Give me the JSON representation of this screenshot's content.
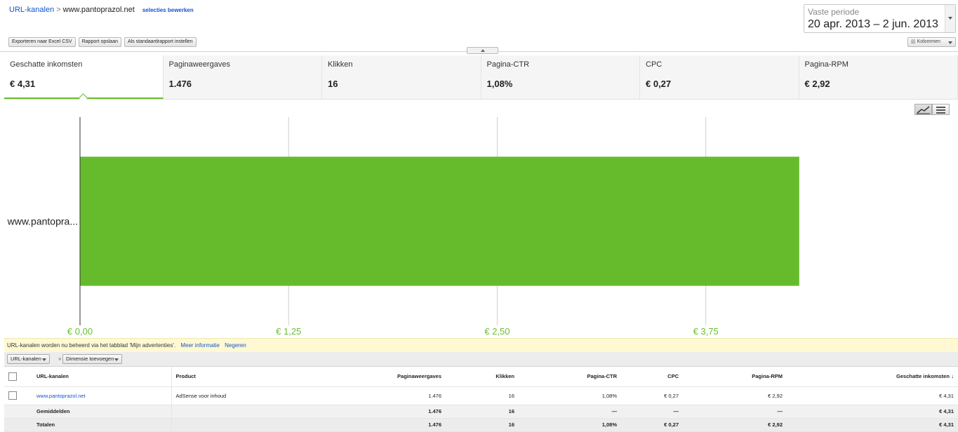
{
  "header": {
    "breadcrumb_root": "URL-kanalen",
    "breadcrumb_sep": ">",
    "breadcrumb_current": "www.pantoprazol.net",
    "edit_selection": "selecties bewerken",
    "buttons": [
      "Exporteren naar Excel CSV",
      "Rapport opslaan",
      "Als standaardrapport instellen"
    ],
    "period_label": "Vaste periode",
    "period_value": "20 apr. 2013 – 2 jun. 2013",
    "columns_label": "Kolommen"
  },
  "metrics": [
    {
      "name": "Geschatte inkomsten",
      "value": "€ 4,31"
    },
    {
      "name": "Paginaweergaves",
      "value": "1.476"
    },
    {
      "name": "Klikken",
      "value": "16"
    },
    {
      "name": "Pagina-CTR",
      "value": "1,08%"
    },
    {
      "name": "CPC",
      "value": "€ 0,27"
    },
    {
      "name": "Pagina-RPM",
      "value": "€ 2,92"
    }
  ],
  "chart_data": {
    "type": "bar",
    "orientation": "horizontal",
    "categories": [
      "www.pantopra..."
    ],
    "values": [
      4.31
    ],
    "xlim": [
      0,
      4.5
    ],
    "xticks": [
      0,
      1.25,
      2.5,
      3.75
    ],
    "xtick_labels": [
      "€ 0,00",
      "€ 1,25",
      "€ 2,50",
      "€ 3,75"
    ],
    "color": "#66bb2c",
    "grid": true
  },
  "info": {
    "text": "URL-kanalen worden nu beheerd via het tabblad 'Mijn advertenties'.",
    "more": "Meer informatie",
    "ignore": "Negeren"
  },
  "dimension": {
    "primary": "URL-kanalen",
    "separator": "»",
    "add": "Dimensie toevoegen"
  },
  "table": {
    "headers": [
      "URL-kanalen",
      "Product",
      "Paginaweergaves",
      "Klikken",
      "Pagina-CTR",
      "CPC",
      "Pagina-RPM",
      "Geschatte inkomsten"
    ],
    "sort_icon": "↓",
    "rows": [
      [
        "www.pantoprazol.net",
        "AdSense voor inhoud",
        "1.476",
        "16",
        "1,08%",
        "€ 0,27",
        "€ 2,92",
        "€ 4,31"
      ]
    ],
    "averages": [
      "Gemiddelden",
      "",
      "1.476",
      "16",
      "—",
      "—",
      "—",
      "€ 4,31"
    ],
    "totals": [
      "Totalen",
      "",
      "1.476",
      "16",
      "1,08%",
      "€ 0,27",
      "€ 2,92",
      "€ 4,31"
    ]
  }
}
